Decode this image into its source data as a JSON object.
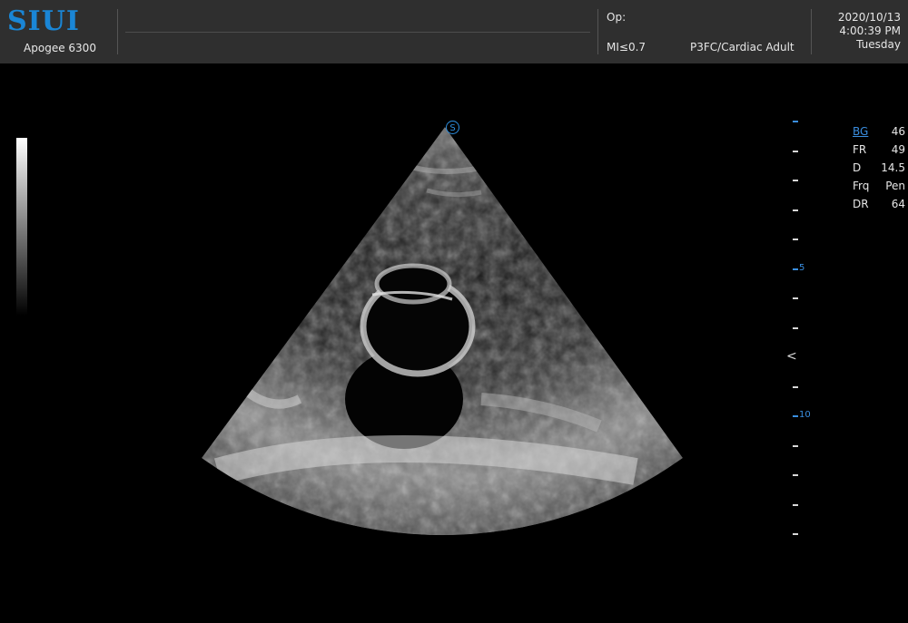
{
  "header": {
    "brand": "SIUI",
    "model": "Apogee 6300",
    "operator_label": "Op:",
    "mi": "MI≤0.7",
    "probe_preset": "P3FC/Cardiac Adult",
    "date": "2020/10/13",
    "time": "4:00:39 PM",
    "weekday": "Tuesday"
  },
  "scan": {
    "probe_orientation_marker": "S",
    "depth_labels": [
      "5",
      "10"
    ],
    "focus_marker": "<"
  },
  "params": [
    {
      "label": "BG",
      "value": "46"
    },
    {
      "label": "FR",
      "value": "49"
    },
    {
      "label": "D",
      "value": "14.5"
    },
    {
      "label": "Frq",
      "value": "Pen"
    },
    {
      "label": "DR",
      "value": "64"
    }
  ],
  "colors": {
    "brand_blue": "#1a86d6",
    "accent_blue": "#3a8ee0",
    "topbar_bg": "#2f2f2f"
  }
}
